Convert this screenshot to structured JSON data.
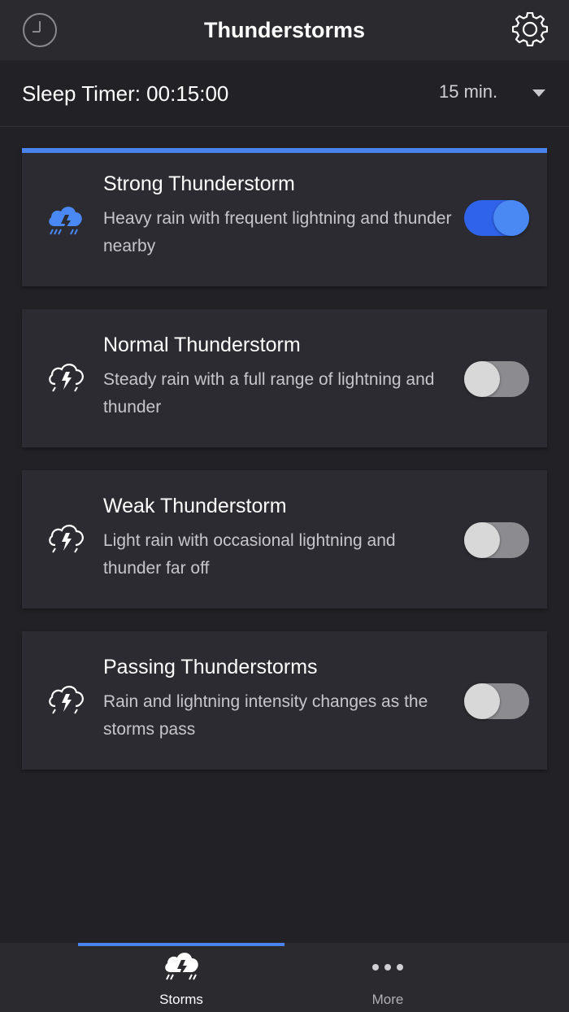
{
  "header": {
    "title": "Thunderstorms",
    "left_icon": "clock-icon",
    "right_icon": "gear-icon"
  },
  "timer": {
    "label": "Sleep Timer: 00:15:00",
    "selected": "15 min."
  },
  "colors": {
    "accent": "#4a82ee",
    "toggle_on": "#2f63ea",
    "background": "#222226",
    "card": "#2b2b31"
  },
  "sounds": [
    {
      "title": "Strong Thunderstorm",
      "description": "Heavy rain with frequent lightning and thunder nearby",
      "on": true,
      "icon": "storm-cloud-icon"
    },
    {
      "title": "Normal Thunderstorm",
      "description": "Steady rain with a full range of lightning and thunder",
      "on": false,
      "icon": "storm-cloud-icon"
    },
    {
      "title": "Weak Thunderstorm",
      "description": "Light rain with occasional lightning and thunder far off",
      "on": false,
      "icon": "storm-cloud-icon"
    },
    {
      "title": "Passing Thunderstorms",
      "description": "Rain and lightning intensity changes as the storms pass",
      "on": false,
      "icon": "storm-cloud-icon"
    }
  ],
  "tabs": [
    {
      "label": "Storms",
      "icon": "storm-cloud-icon",
      "active": true
    },
    {
      "label": "More",
      "icon": "more-dots-icon",
      "active": false
    }
  ]
}
